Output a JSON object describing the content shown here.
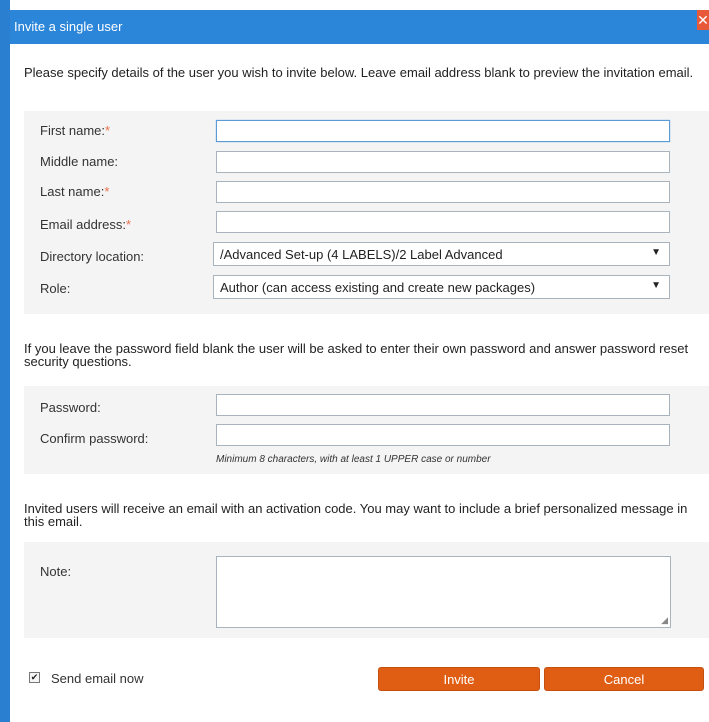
{
  "window": {
    "title": "Invite a single user",
    "close_glyph": "✕"
  },
  "intro_text": "Please specify details of the user you wish to invite below. Leave email address blank to preview the invitation email.",
  "user_details": {
    "first_name_label": "First name:",
    "middle_name_label": "Middle name:",
    "last_name_label": "Last name:",
    "email_label": "Email address:",
    "directory_label": "Directory location:",
    "role_label": "Role:",
    "required_marker": "*",
    "first_name_value": "",
    "middle_name_value": "",
    "last_name_value": "",
    "email_value": "",
    "directory_value": "/Advanced Set-up (4 LABELS)/2 Label Advanced",
    "role_value": "Author (can access existing and create new packages)"
  },
  "password_text": "If you leave the password field blank the user will be asked to enter their own password and answer password reset security questions.",
  "password_section": {
    "password_label": "Password:",
    "confirm_label": "Confirm password:",
    "hint": "Minimum 8 characters, with at least 1 UPPER case or number",
    "password_value": "",
    "confirm_value": ""
  },
  "invite_text": "Invited users will receive an email with an activation code. You may want to include a brief personalized message in this email.",
  "note_section": {
    "note_label": "Note:",
    "note_value": ""
  },
  "footer": {
    "send_email_label": "Send email now",
    "send_email_checked": true,
    "invite_button": "Invite",
    "cancel_button": "Cancel"
  },
  "colors": {
    "titlebar": "#2b85d8",
    "accent_button": "#e05e14",
    "close_button": "#e8593a",
    "panel_bg": "#f4f4f4"
  },
  "icons": {
    "close": "close-icon",
    "dropdown": "chevron-down-icon",
    "check": "check-icon"
  }
}
